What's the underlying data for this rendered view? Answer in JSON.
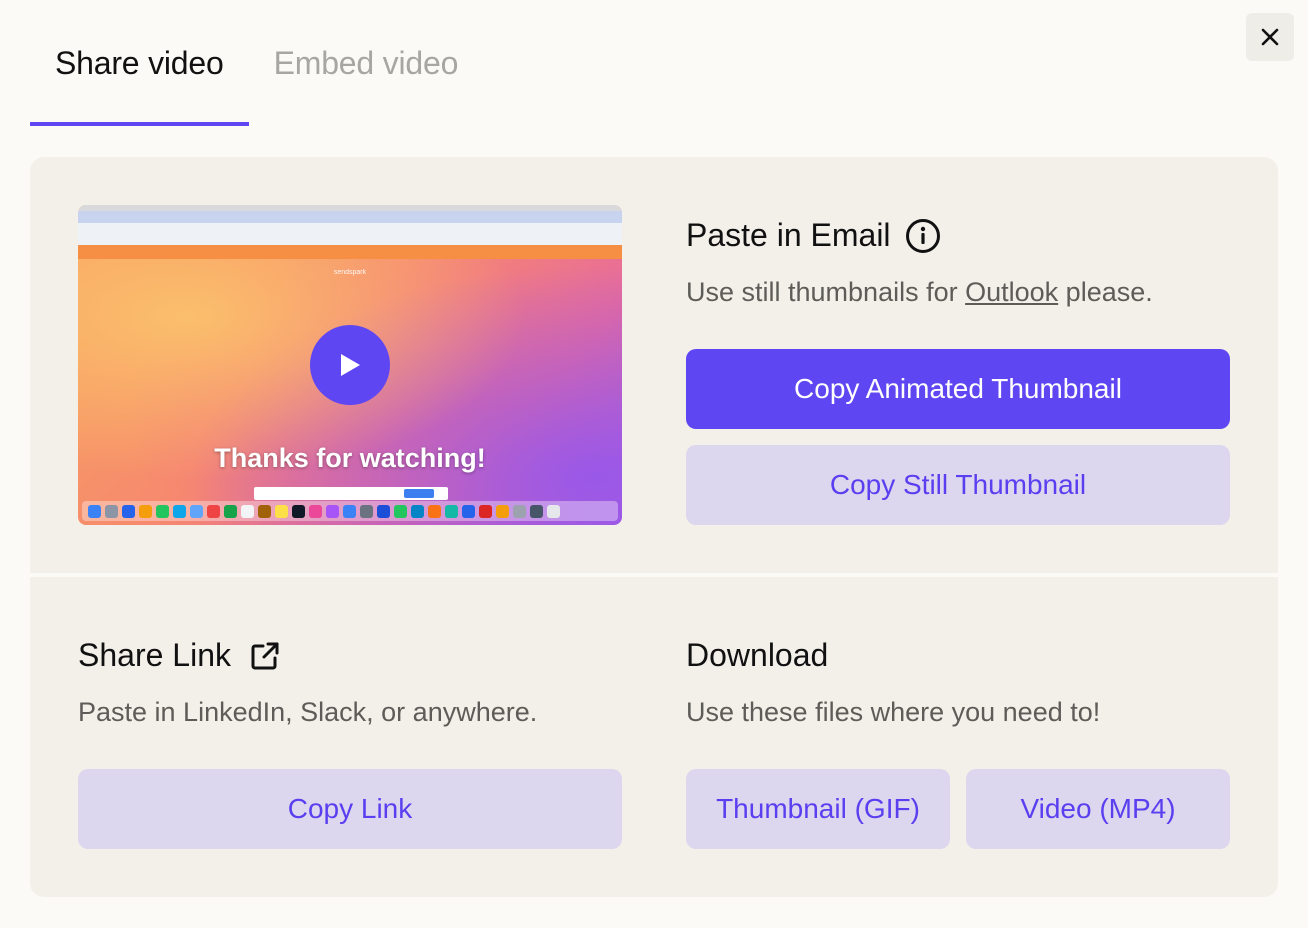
{
  "tabs": [
    {
      "label": "Share video",
      "active": true
    },
    {
      "label": "Embed video",
      "active": false
    }
  ],
  "close_icon": "close-icon",
  "colors": {
    "accent": "#5f46f3",
    "secondary_button_bg": "#dcd6ee",
    "panel_bg": "#f3f0ea",
    "page_bg": "#fcfaf6"
  },
  "preview": {
    "caption": "Thanks for watching!",
    "play_icon": "play-icon",
    "logo_text": "sendspark"
  },
  "email": {
    "title": "Paste in Email",
    "info_icon": "info-icon",
    "subtitle_before": "Use still thumbnails for ",
    "subtitle_link": "Outlook",
    "subtitle_after": " please.",
    "copy_animated_label": "Copy Animated Thumbnail",
    "copy_still_label": "Copy Still Thumbnail"
  },
  "share_link": {
    "title": "Share Link",
    "external_icon": "external-link-icon",
    "subtitle": "Paste in LinkedIn, Slack, or anywhere.",
    "copy_link_label": "Copy Link"
  },
  "download": {
    "title": "Download",
    "subtitle": "Use these files where you need to!",
    "gif_label": "Thumbnail (GIF)",
    "mp4_label": "Video (MP4)"
  }
}
